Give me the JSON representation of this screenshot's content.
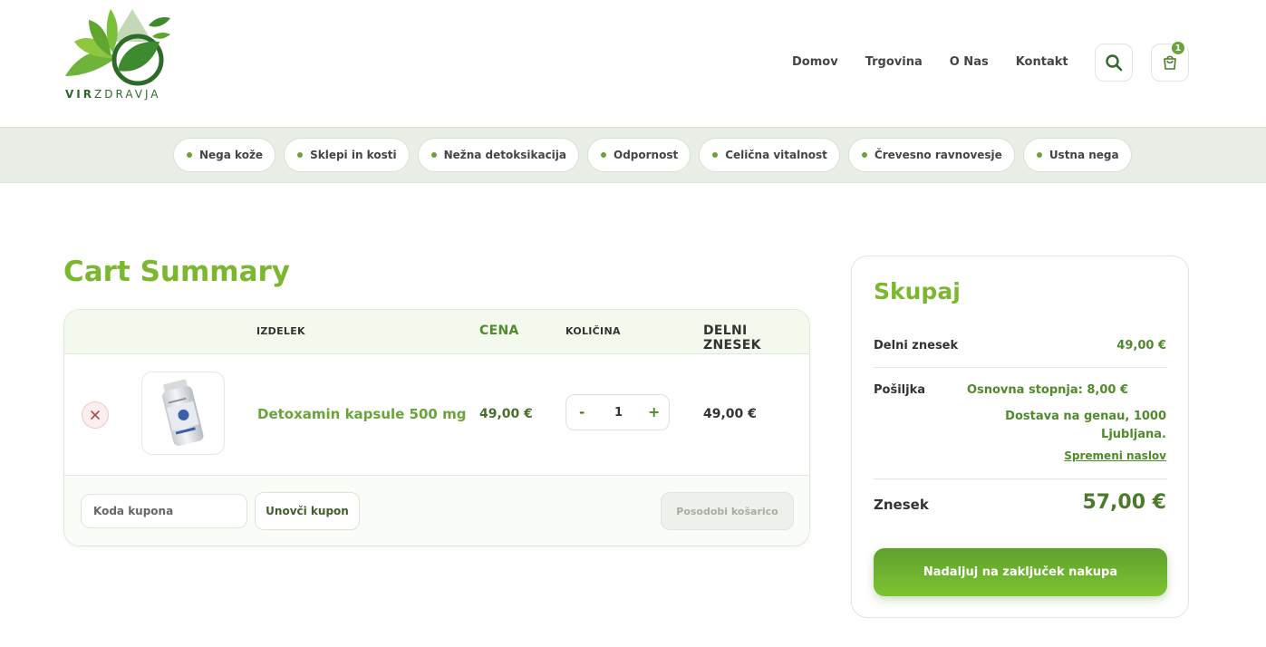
{
  "brand": {
    "name_part1": "VIR",
    "name_part2": "ZDRAVJA",
    "accent": "#7cb82f",
    "dark_green": "#4f8a2b"
  },
  "nav": {
    "items": [
      "Domov",
      "Trgovina",
      "O Nas",
      "Kontakt"
    ],
    "search_icon": "search-icon",
    "cart_icon": "shopping-bag-icon",
    "cart_count": "1"
  },
  "categories": [
    "Nega kože",
    "Sklepi in kosti",
    "Nežna detoksikacija",
    "Odpornost",
    "Celična vitalnost",
    "Črevesno ravnovesje",
    "Ustna nega"
  ],
  "cart": {
    "title": "Cart Summary",
    "columns": {
      "product": "IZDELEK",
      "price": "CENA",
      "quantity": "KOLIČINA",
      "subtotal": "DELNI ZNESEK"
    },
    "items": [
      {
        "name": "Detoxamin kapsule 500 mg",
        "price": "49,00 €",
        "quantity": "1",
        "subtotal": "49,00 €",
        "remove_icon": "close-icon"
      }
    ],
    "qty_minus": "-",
    "qty_plus": "+",
    "coupon_placeholder": "Koda kupona",
    "coupon_button": "Unovči kupon",
    "update_button": "Posodobi košarico"
  },
  "summary": {
    "title": "Skupaj",
    "subtotal_label": "Delni znesek",
    "subtotal_value": "49,00 €",
    "shipping_label": "Pošiljka",
    "shipping_rate": "Osnovna stopnja: 8,00 €",
    "shipping_address": "Dostava na genau, 1000 Ljubljana.",
    "change_address": "Spremeni naslov",
    "total_label": "Znesek",
    "total_value": "57,00 €",
    "checkout_button": "Nadaljuj na zaključek nakupa"
  }
}
